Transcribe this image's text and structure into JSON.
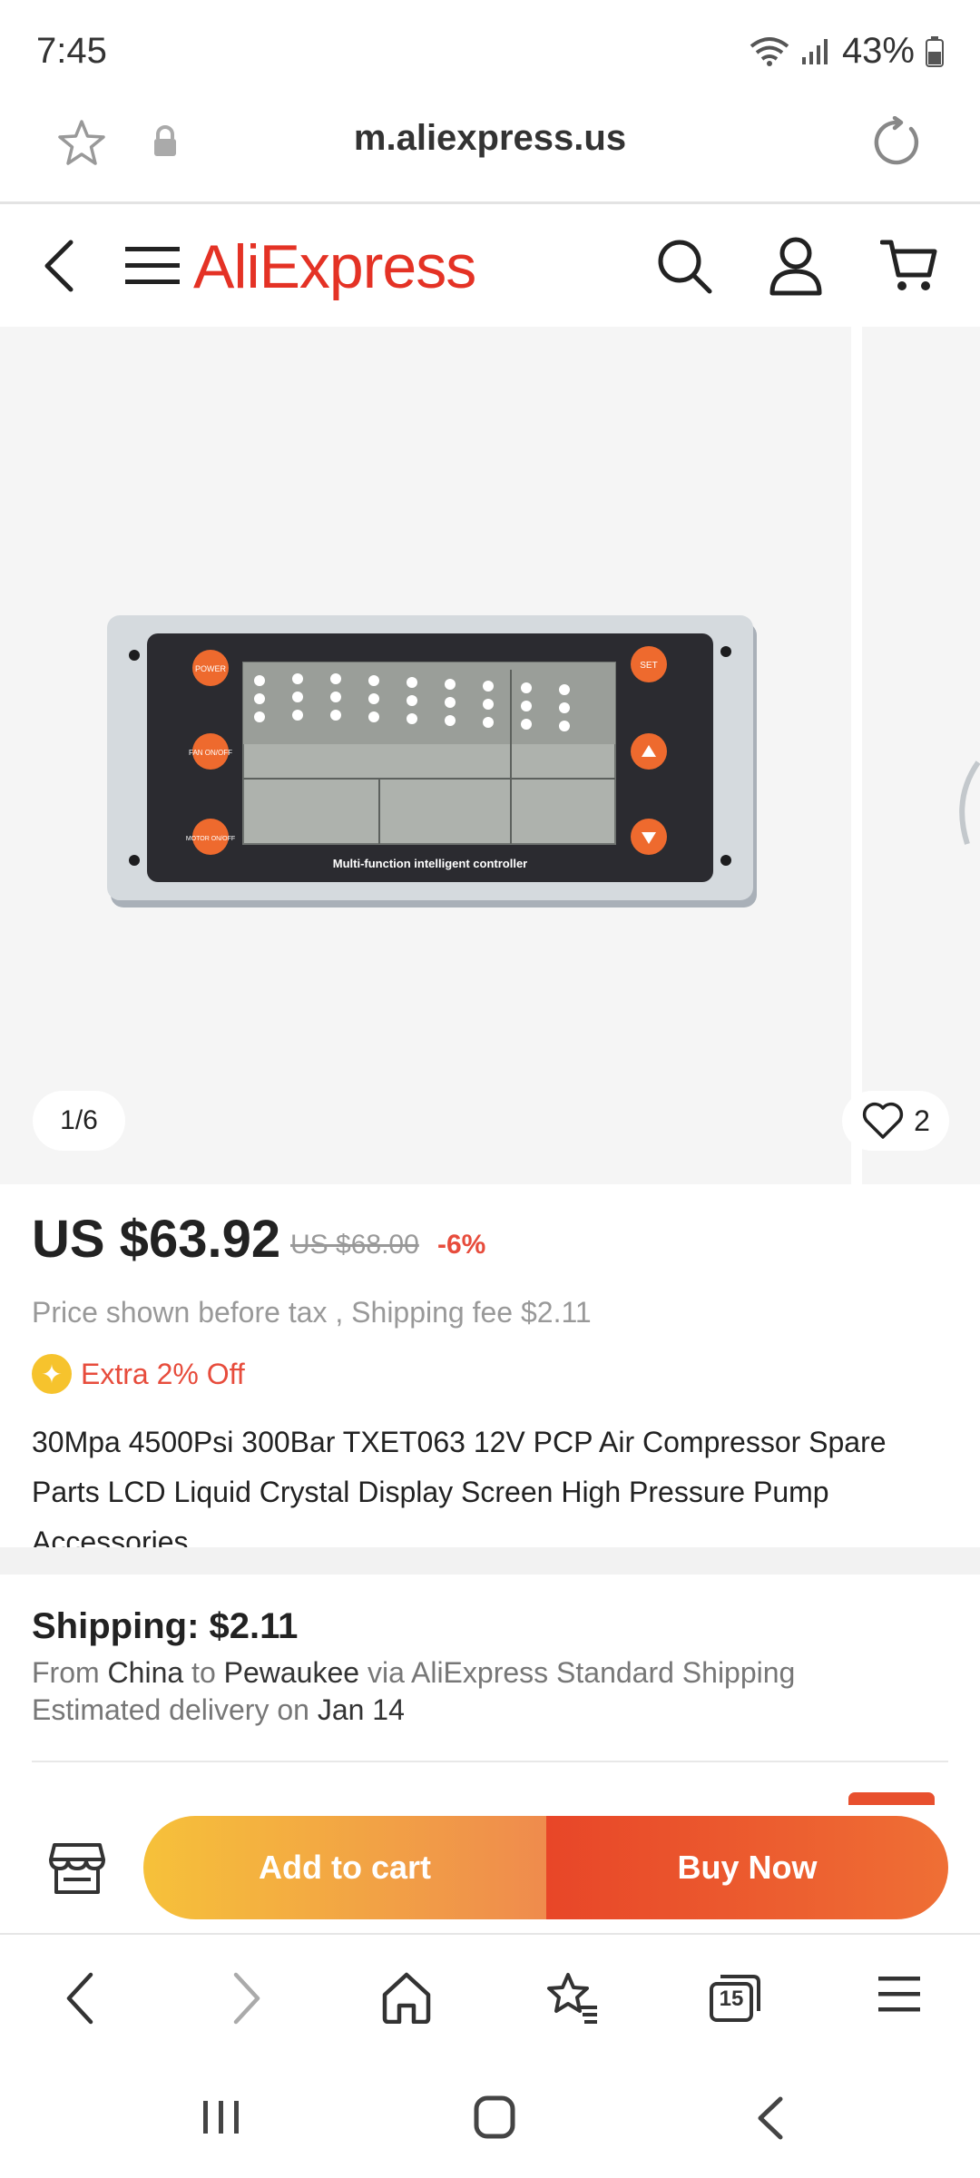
{
  "status_bar": {
    "time": "7:45",
    "battery": "43%"
  },
  "browser": {
    "url": "m.aliexpress.us",
    "tab_count": "15"
  },
  "site": {
    "logo": "AliExpress"
  },
  "gallery": {
    "counter": "1/6",
    "likes": "2",
    "product_panel_caption": "Multi-function intelligent controller",
    "button_labels": [
      "POWER",
      "FAN ON/OFF",
      "MOTOR ON/OFF",
      "SET"
    ]
  },
  "product": {
    "price": "US $63.92",
    "original_price": "US $68.00",
    "discount": "-6%",
    "tax_note": "Price shown before tax , Shipping fee $2.11",
    "extra_off": "Extra 2% Off",
    "title": "30Mpa 4500Psi 300Bar TXET063 12V PCP Air Compressor Spare Parts LCD Liquid Crystal Display Screen High Pressure Pump Accessories"
  },
  "shipping": {
    "heading": "Shipping: $2.11",
    "from_label": "From",
    "from": "China",
    "to_label": "to",
    "to": "Pewaukee",
    "via": "via AliExpress Standard Shipping",
    "delivery_label": "Estimated delivery on",
    "delivery_date": "Jan 14"
  },
  "actions": {
    "add_to_cart": "Add to cart",
    "buy_now": "Buy Now"
  },
  "colors": {
    "brand": "#e43225",
    "cart_start": "#f6c13a",
    "buy": "#e84628",
    "discount": "#e74c3c"
  }
}
